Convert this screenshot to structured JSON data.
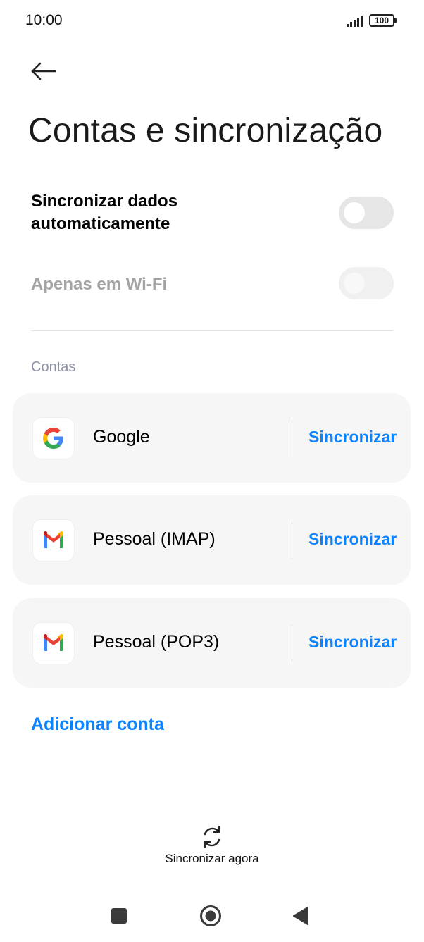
{
  "status_bar": {
    "time": "10:00",
    "battery": "100"
  },
  "page": {
    "title": "Contas e sincronização"
  },
  "settings": {
    "auto_sync": {
      "label": "Sincronizar dados automaticamente",
      "enabled": false
    },
    "wifi_only": {
      "label": "Apenas em Wi-Fi",
      "enabled": false,
      "disabled": true
    }
  },
  "accounts_section": {
    "header": "Contas",
    "items": [
      {
        "name": "Google",
        "icon": "google-icon",
        "action": "Sincronizar"
      },
      {
        "name": "Pessoal (IMAP)",
        "icon": "gmail-icon",
        "action": "Sincronizar"
      },
      {
        "name": "Pessoal (POP3)",
        "icon": "gmail-icon",
        "action": "Sincronizar"
      }
    ]
  },
  "add_account": "Adicionar conta",
  "sync_now": {
    "label": "Sincronizar agora",
    "icon": "sync-icon"
  },
  "colors": {
    "accent": "#0d84ff",
    "card_bg": "#f6f6f6",
    "toggle_off": "#e6e6e6"
  },
  "nav_bar": {
    "icons": [
      "recents-square-icon",
      "home-circle-icon",
      "back-triangle-icon"
    ]
  }
}
